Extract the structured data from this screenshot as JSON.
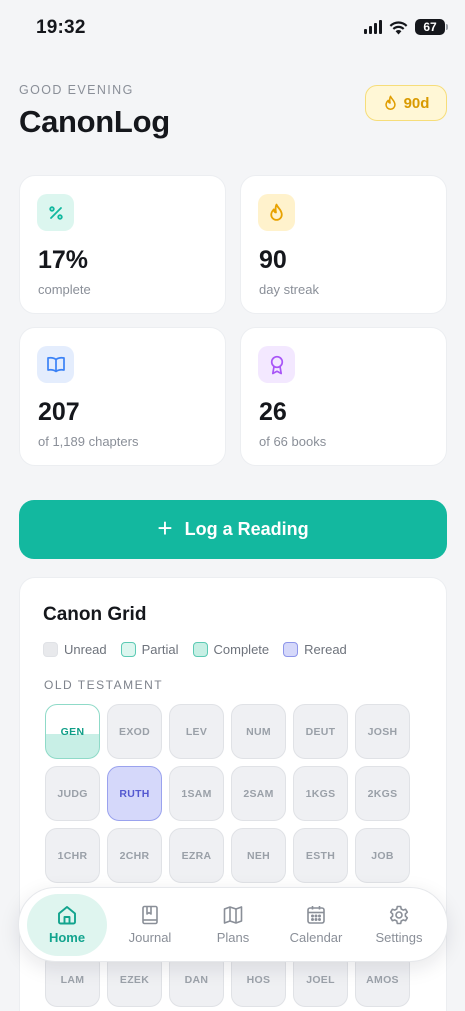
{
  "status_bar": {
    "time": "19:32",
    "battery": "67"
  },
  "header": {
    "greeting": "GOOD EVENING",
    "title": "CanonLog",
    "streak_badge": "90d"
  },
  "stats": [
    {
      "value": "17%",
      "label": "complete",
      "icon": "percent-icon",
      "color": "#12b89f"
    },
    {
      "value": "90",
      "label": "day streak",
      "icon": "flame-icon",
      "color": "#e8a200"
    },
    {
      "value": "207",
      "label": "of 1,189 chapters",
      "icon": "book-icon",
      "color": "#3b82f6"
    },
    {
      "value": "26",
      "label": "of 66 books",
      "icon": "award-icon",
      "color": "#a855f7"
    }
  ],
  "log_button": {
    "label": "Log a Reading"
  },
  "canon_grid": {
    "title": "Canon Grid",
    "legend": [
      "Unread",
      "Partial",
      "Complete",
      "Reread"
    ],
    "section": "OLD TESTAMENT",
    "books": [
      {
        "abbr": "GEN",
        "state": "partial"
      },
      {
        "abbr": "EXOD",
        "state": "unread"
      },
      {
        "abbr": "LEV",
        "state": "unread"
      },
      {
        "abbr": "NUM",
        "state": "unread"
      },
      {
        "abbr": "DEUT",
        "state": "unread"
      },
      {
        "abbr": "JOSH",
        "state": "unread"
      },
      {
        "abbr": "JUDG",
        "state": "unread"
      },
      {
        "abbr": "RUTH",
        "state": "reread"
      },
      {
        "abbr": "1SAM",
        "state": "unread"
      },
      {
        "abbr": "2SAM",
        "state": "unread"
      },
      {
        "abbr": "1KGS",
        "state": "unread"
      },
      {
        "abbr": "2KGS",
        "state": "unread"
      },
      {
        "abbr": "1CHR",
        "state": "unread"
      },
      {
        "abbr": "2CHR",
        "state": "unread"
      },
      {
        "abbr": "EZRA",
        "state": "unread"
      },
      {
        "abbr": "NEH",
        "state": "unread"
      },
      {
        "abbr": "ESTH",
        "state": "unread"
      },
      {
        "abbr": "JOB",
        "state": "unread"
      },
      {
        "abbr": "",
        "state": "unread"
      },
      {
        "abbr": "",
        "state": "unread"
      },
      {
        "abbr": "",
        "state": "unread"
      },
      {
        "abbr": "",
        "state": "unread"
      },
      {
        "abbr": "",
        "state": "unread"
      },
      {
        "abbr": "",
        "state": "unread"
      },
      {
        "abbr": "LAM",
        "state": "unread"
      },
      {
        "abbr": "EZEK",
        "state": "unread"
      },
      {
        "abbr": "DAN",
        "state": "unread"
      },
      {
        "abbr": "HOS",
        "state": "unread"
      },
      {
        "abbr": "JOEL",
        "state": "unread"
      },
      {
        "abbr": "AMOS",
        "state": "unread"
      }
    ]
  },
  "nav": {
    "items": [
      {
        "label": "Home",
        "icon": "home-icon",
        "active": true
      },
      {
        "label": "Journal",
        "icon": "journal-icon",
        "active": false
      },
      {
        "label": "Plans",
        "icon": "map-icon",
        "active": false
      },
      {
        "label": "Calendar",
        "icon": "calendar-icon",
        "active": false
      },
      {
        "label": "Settings",
        "icon": "gear-icon",
        "active": false
      }
    ]
  },
  "colors": {
    "accent": "#13b89f",
    "streak": "#d99a00",
    "reread": "#5458d0"
  }
}
